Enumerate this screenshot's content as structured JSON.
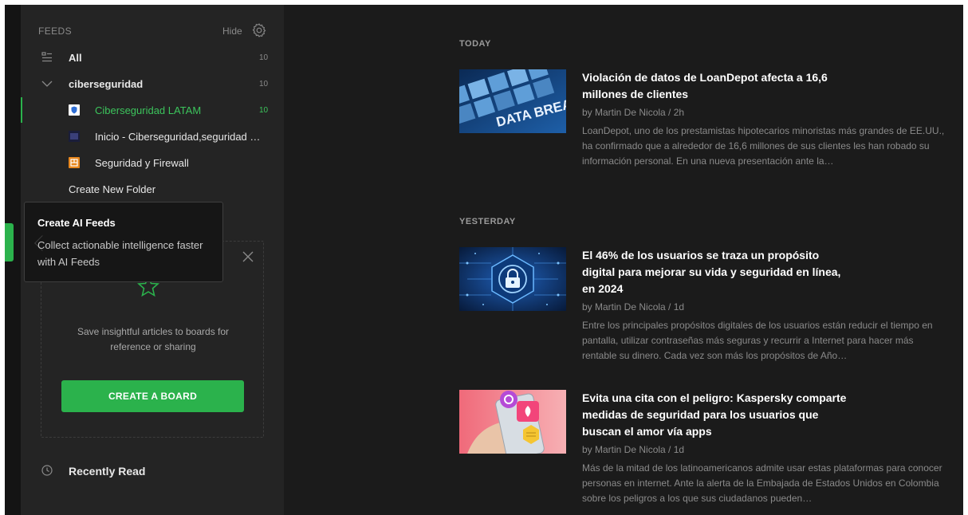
{
  "sidebar": {
    "feeds_label": "FEEDS",
    "hide_label": "Hide",
    "all": {
      "label": "All",
      "count": "10"
    },
    "folder": {
      "label": "ciberseguridad",
      "count": "10"
    },
    "feeds": [
      {
        "label": "Ciberseguridad LATAM",
        "count": "10"
      },
      {
        "label": "Inicio - Ciberseguridad,seguridad …",
        "count": ""
      },
      {
        "label": "Seguridad y Firewall",
        "count": ""
      }
    ],
    "create_folder": "Create New Folder",
    "recently_read": "Recently Read"
  },
  "tooltip": {
    "title": "Create AI Feeds",
    "body": "Collect actionable intelligence faster with AI Feeds"
  },
  "board_promo": {
    "description": "Save insightful articles to boards for reference or sharing",
    "button": "CREATE A BOARD"
  },
  "main": {
    "sections": [
      {
        "heading": "TODAY",
        "articles": [
          {
            "title": "Violación de datos de LoanDepot afecta a 16,6 millones de clientes",
            "meta": "by Martin De Nicola / 2h",
            "snippet": "LoanDepot, uno de los prestamistas hipotecarios minoristas más grandes de EE.UU., ha confirmado que a alrededor de 16,6 millones de sus clientes les han robado su información personal. En una nueva presentación ante la…",
            "thumb_text": "DATA BREA"
          }
        ]
      },
      {
        "heading": "YESTERDAY",
        "articles": [
          {
            "title": "El 46% de los usuarios se traza un propósito digital para mejorar su vida y seguridad en línea, en 2024",
            "meta": "by Martin De Nicola / 1d",
            "snippet": "Entre los principales propósitos digitales de los usuarios están reducir el tiempo en pantalla, utilizar contraseñas más seguras y recurrir a Internet para hacer más rentable su dinero. Cada vez son más los propósitos de Año…"
          },
          {
            "title": "Evita una cita con el peligro: Kaspersky comparte medidas de seguridad para los usuarios que buscan el amor vía apps",
            "meta": "by Martin De Nicola / 1d",
            "snippet": "Más de la mitad de los latinoamericanos admite usar estas plataformas para conocer personas en internet. Ante la alerta de la Embajada de Estados Unidos en Colombia sobre los peligros a los que sus ciudadanos pueden…"
          }
        ]
      }
    ]
  },
  "colors": {
    "accent": "#2bb24c",
    "sidebar_bg": "#242424",
    "main_bg": "#1b1b1b",
    "tooltip_bg": "#161616"
  }
}
